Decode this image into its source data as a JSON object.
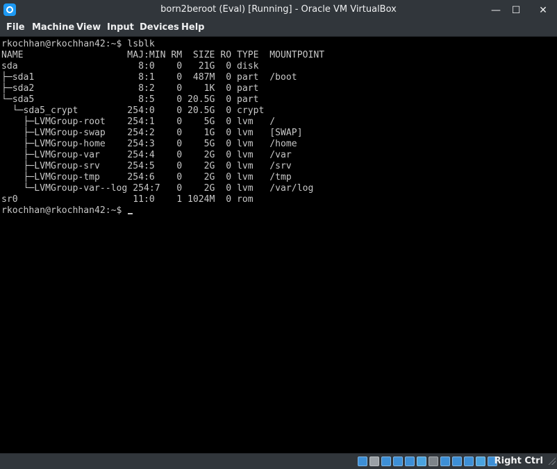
{
  "window": {
    "title": "born2beroot (Eval) [Running] - Oracle VM VirtualBox",
    "minimize_glyph": "—",
    "maximize_glyph": "☐",
    "close_glyph": "✕"
  },
  "menu": {
    "items": [
      "File",
      "Machine",
      "View",
      "Input",
      "Devices",
      "Help"
    ]
  },
  "terminal": {
    "lines": [
      "rkochhan@rkochhan42:~$ lsblk",
      "NAME                   MAJ:MIN RM  SIZE RO TYPE  MOUNTPOINT",
      "sda                      8:0    0   21G  0 disk",
      "├─sda1                   8:1    0  487M  0 part  /boot",
      "├─sda2                   8:2    0    1K  0 part",
      "└─sda5                   8:5    0 20.5G  0 part",
      "  └─sda5_crypt         254:0    0 20.5G  0 crypt",
      "    ├─LVMGroup-root    254:1    0    5G  0 lvm   /",
      "    ├─LVMGroup-swap    254:2    0    1G  0 lvm   [SWAP]",
      "    ├─LVMGroup-home    254:3    0    5G  0 lvm   /home",
      "    ├─LVMGroup-var     254:4    0    2G  0 lvm   /var",
      "    ├─LVMGroup-srv     254:5    0    2G  0 lvm   /srv",
      "    ├─LVMGroup-tmp     254:6    0    2G  0 lvm   /tmp",
      "    └─LVMGroup-var--log 254:7   0    2G  0 lvm   /var/log",
      "sr0                     11:0    1 1024M  0 rom",
      "rkochhan@rkochhan42:~$ "
    ]
  },
  "statusbar": {
    "host_key": "Right Ctrl",
    "icons": [
      {
        "name": "hard-disk-icon",
        "color": "#3d8fd6"
      },
      {
        "name": "optical-drive-icon",
        "color": "#9aa0a6"
      },
      {
        "name": "audio-icon",
        "color": "#3d8fd6"
      },
      {
        "name": "network-icon",
        "color": "#3d8fd6"
      },
      {
        "name": "usb-icon",
        "color": "#3d8fd6"
      },
      {
        "name": "shared-folders-icon",
        "color": "#4aa3df"
      },
      {
        "name": "display-icon",
        "color": "#7d848a"
      },
      {
        "name": "video-capture-icon",
        "color": "#3d8fd6"
      },
      {
        "name": "recording-icon",
        "color": "#3d8fd6"
      },
      {
        "name": "virtualization-icon",
        "color": "#3d8fd6"
      },
      {
        "name": "mouse-integration-icon",
        "color": "#4aa3df"
      },
      {
        "name": "keyboard-capture-icon",
        "color": "#3d8fd6"
      }
    ]
  }
}
